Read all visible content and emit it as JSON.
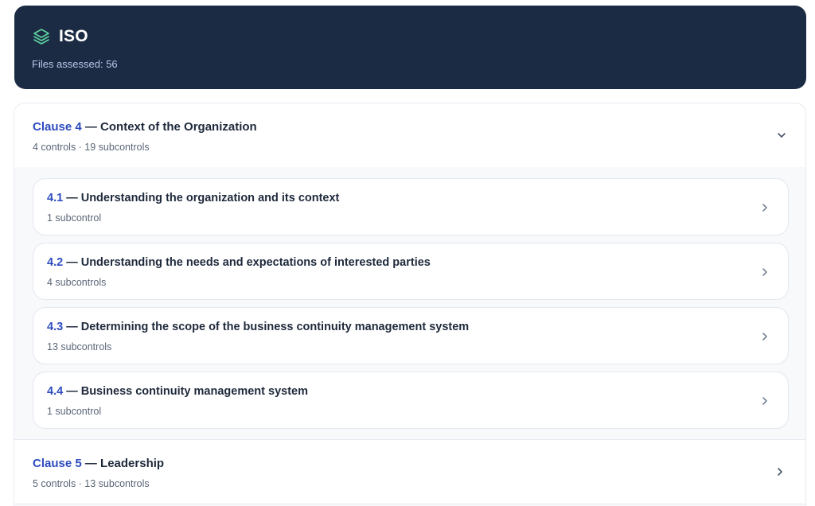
{
  "header": {
    "title": "ISO",
    "files_assessed": "Files assessed: 56",
    "icon": "layers-icon",
    "accent_color": "#5fd3a0"
  },
  "clauses": [
    {
      "num": "Clause 4",
      "title": " — Context of the Organization",
      "meta": "4 controls · 19 subcontrols",
      "expanded": true,
      "controls": [
        {
          "num": "4.1",
          "title": " — Understanding the organization and its context",
          "meta": "1 subcontrol"
        },
        {
          "num": "4.2",
          "title": " — Understanding the needs and expectations of interested parties",
          "meta": "4 subcontrols"
        },
        {
          "num": "4.3",
          "title": " — Determining the scope of the business continuity management system",
          "meta": "13 subcontrols"
        },
        {
          "num": "4.4",
          "title": " — Business continuity management system",
          "meta": "1 subcontrol"
        }
      ]
    },
    {
      "num": "Clause 5",
      "title": " — Leadership",
      "meta": "5 controls · 13 subcontrols",
      "expanded": false
    }
  ],
  "colors": {
    "header_bg": "#1c2b44",
    "link_blue": "#2d4bbf"
  }
}
